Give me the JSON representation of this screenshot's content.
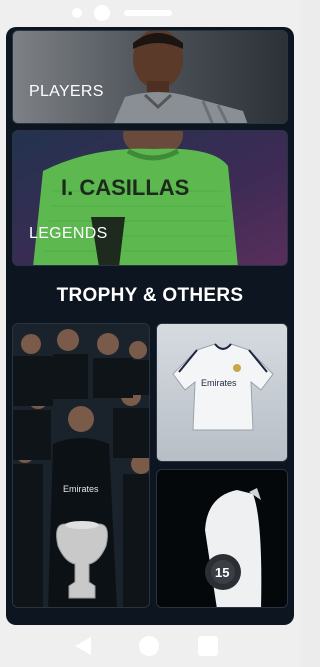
{
  "status_bar": {
    "notch_icon_1": "camera-dot-icon",
    "notch_icon_2": "camera-lens-icon",
    "notch_icon_3": "speaker-grille-icon"
  },
  "cards": {
    "players": {
      "label": "PLAYERS",
      "image": "player-photo"
    },
    "legends": {
      "label": "LEGENDS",
      "image": "goalkeeper-jersey-photo",
      "jersey_text": "I. CASILLAS"
    }
  },
  "section": {
    "title": "TROPHY & OTHERS"
  },
  "tiles": {
    "trophy": {
      "image": "team-trophy-celebration-photo",
      "sponsor": "Emirates"
    },
    "shirt": {
      "image": "white-kit-shirt-photo",
      "sponsor": "Emirates"
    },
    "badge": {
      "image": "ucl-15-badge-photo",
      "number": "15"
    }
  },
  "bottom_nav": {
    "back": "back-triangle-icon",
    "home": "home-circle-icon",
    "recent": "recent-square-icon"
  },
  "colors": {
    "screen_bg": "#0d1620",
    "device_bg": "#efefef",
    "keeper_green": "#59b84e",
    "text": "#ffffff"
  }
}
